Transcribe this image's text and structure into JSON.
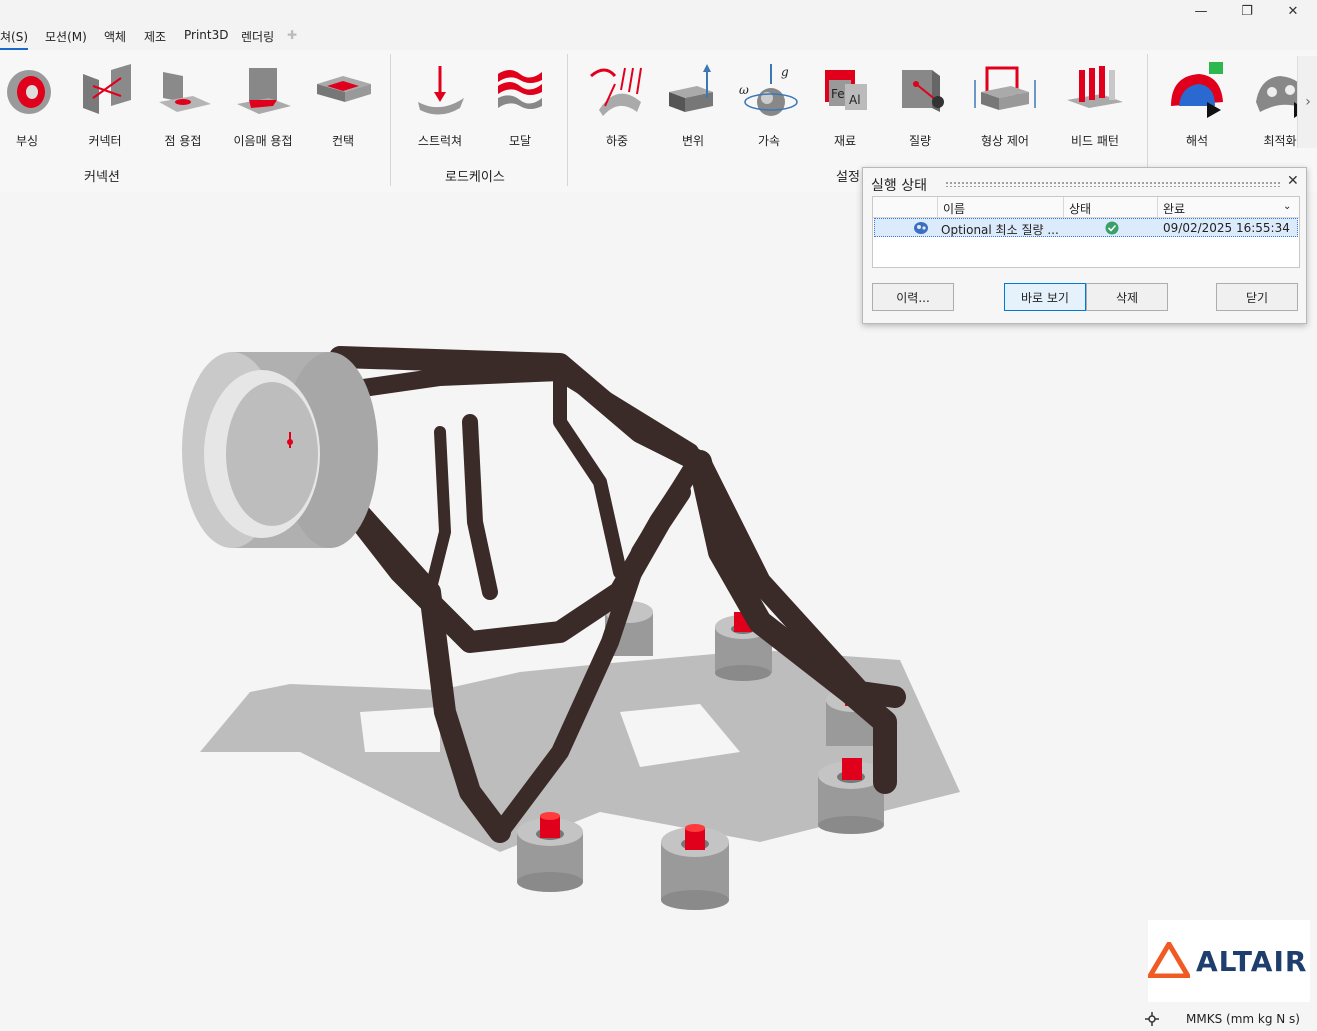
{
  "menu": {
    "items": [
      "쳐(S)",
      "모션(M)",
      "액체",
      "제조",
      "Print3D",
      "렌더링"
    ],
    "add_symbol": "✚"
  },
  "ribbon": {
    "tools": [
      {
        "label": "부싱",
        "icon": "bushing-icon"
      },
      {
        "label": "커넥터",
        "icon": "connector-icon"
      },
      {
        "label": "점 용접",
        "icon": "spot-weld-icon"
      },
      {
        "label": "이음매 용접",
        "icon": "seam-weld-icon"
      },
      {
        "label": "컨택",
        "icon": "contact-icon"
      },
      {
        "label": "스트럭쳐",
        "icon": "structure-icon"
      },
      {
        "label": "모달",
        "icon": "modal-icon"
      },
      {
        "label": "하중",
        "icon": "load-icon"
      },
      {
        "label": "변위",
        "icon": "displacement-icon"
      },
      {
        "label": "가속",
        "icon": "acceleration-icon"
      },
      {
        "label": "재료",
        "icon": "material-icon"
      },
      {
        "label": "질량",
        "icon": "mass-icon"
      },
      {
        "label": "형상 제어",
        "icon": "shape-control-icon"
      },
      {
        "label": "비드 패턴",
        "icon": "bead-pattern-icon"
      },
      {
        "label": "해석",
        "icon": "analysis-icon"
      },
      {
        "label": "최적화",
        "icon": "optimize-icon"
      }
    ],
    "groups": [
      "커넥션",
      "로드케이스",
      "설정"
    ]
  },
  "dialog": {
    "title": "실행 상태",
    "columns": [
      "이름",
      "상태",
      "완료"
    ],
    "rows": [
      {
        "name": "Optional 최소 질량 ...",
        "status": "complete",
        "completed": "09/02/2025 16:55:34"
      }
    ],
    "buttons": {
      "history": "이력...",
      "view": "바로 보기",
      "delete": "삭제",
      "close": "닫기"
    },
    "close_symbol": "✕"
  },
  "window": {
    "minimize": "—",
    "restore": "❐",
    "close": "✕"
  },
  "logo": {
    "text": "ALTAIR"
  },
  "status": {
    "units": "MMKS (mm kg N s)"
  },
  "colors": {
    "accent": "#1b6ac9",
    "part": "#3a2a28",
    "red": "#e0001b",
    "logo_orange": "#f05a23",
    "logo_blue": "#1e3f6e"
  }
}
